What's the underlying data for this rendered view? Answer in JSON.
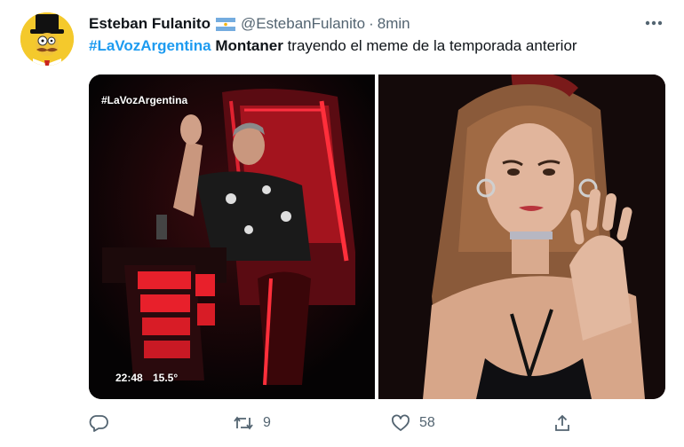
{
  "tweet": {
    "display_name": "Esteban Fulanito",
    "handle": "@EstebanFulanito",
    "separator": "·",
    "time": "8min",
    "flag_icon": "argentina-flag-icon",
    "more_icon": "more-options-icon",
    "text": {
      "hashtag": "#LaVozArgentina",
      "mention_bold": "Montaner",
      "rest": "trayendo el meme de la temporada anterior"
    },
    "media": {
      "left_overlay_hashtag": "#LaVozArgentina",
      "left_overlay_time": "22:48",
      "left_overlay_temp": "15.5°"
    },
    "actions": {
      "reply_icon": "reply-icon",
      "retweet_icon": "retweet-icon",
      "retweet_count": "9",
      "like_icon": "like-icon",
      "like_count": "58",
      "share_icon": "share-icon"
    },
    "colors": {
      "hashtag": "#1d9bf0",
      "muted": "#536471",
      "text": "#0f1419"
    }
  }
}
